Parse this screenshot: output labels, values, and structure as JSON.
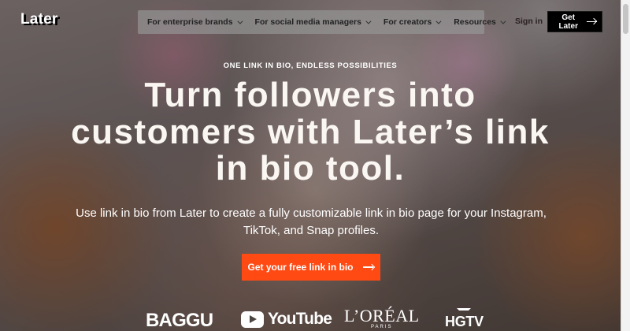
{
  "topbar": {
    "logo": "Later",
    "nav_items": [
      {
        "label": "For enterprise brands"
      },
      {
        "label": "For social media managers"
      },
      {
        "label": "For creators"
      },
      {
        "label": "Resources"
      }
    ],
    "signin": "Sign in",
    "cta_label": "Get Later"
  },
  "hero": {
    "eyebrow": "ONE LINK IN BIO, ENDLESS POSSIBILITIES",
    "headline": "Turn followers into customers with Later’s link in bio tool.",
    "subcopy": "Use link in bio from Later to create a fully customizable link in bio page for your Instagram, TikTok, and Snap profiles.",
    "cta_label": "Get your free link in bio"
  },
  "brands": {
    "items": [
      {
        "name": "BAGGU"
      },
      {
        "name": "YouTube"
      },
      {
        "name": "L’ORÉAL",
        "subtext": "PARIS"
      },
      {
        "name": "HGTV"
      }
    ]
  },
  "colors": {
    "accent": "#ff4a14",
    "black": "#000000",
    "white": "#ffffff"
  },
  "icons": {
    "chevron": "chevron-down-icon",
    "arrow": "arrow-right-icon",
    "youtube": "youtube-play-icon"
  }
}
